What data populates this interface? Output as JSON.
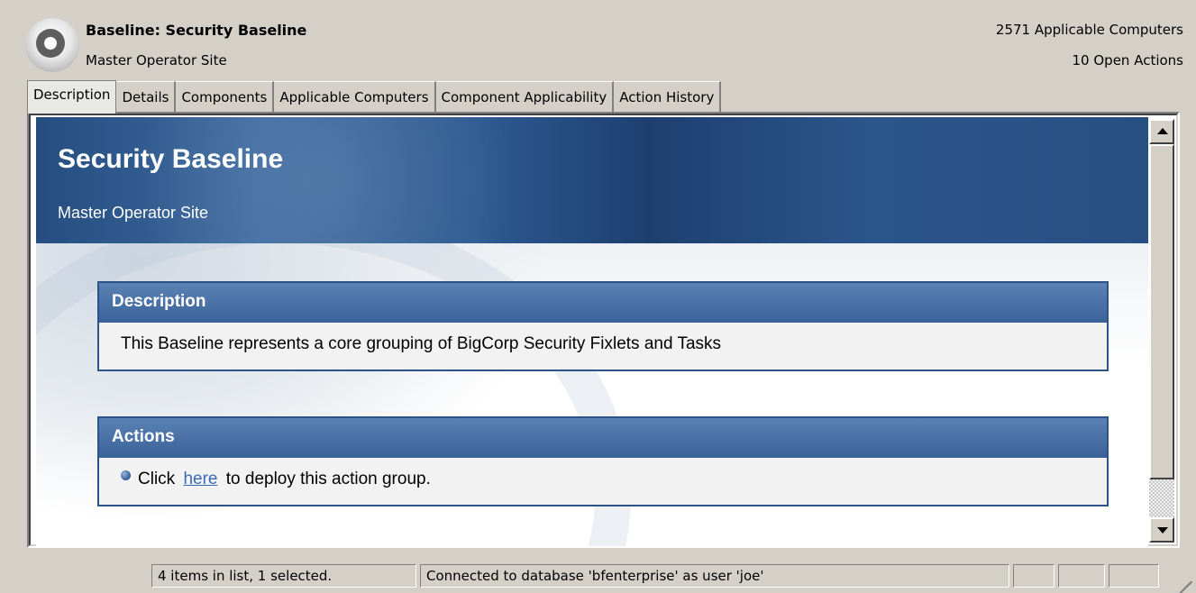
{
  "header": {
    "title": "Baseline: Security Baseline",
    "site": "Master Operator Site",
    "applicable_computers": "2571 Applicable Computers",
    "open_actions": "10 Open Actions"
  },
  "tabs": [
    {
      "label": "Description",
      "active": true
    },
    {
      "label": "Details",
      "active": false
    },
    {
      "label": "Components",
      "active": false
    },
    {
      "label": "Applicable Computers",
      "active": false
    },
    {
      "label": "Component Applicability",
      "active": false
    },
    {
      "label": "Action History",
      "active": false
    }
  ],
  "content": {
    "banner_title": "Security Baseline",
    "banner_subtitle": "Master Operator Site",
    "description_heading": "Description",
    "description_text": "This Baseline represents a core grouping of BigCorp Security Fixlets and Tasks",
    "actions_heading": "Actions",
    "action_prefix": "Click",
    "action_link": "here",
    "action_suffix": "to deploy this action group."
  },
  "status_bar": {
    "items": "4 items in list, 1 selected.",
    "connection": "Connected to database 'bfenterprise' as user 'joe'"
  },
  "colors": {
    "banner": "#2b568a",
    "panel_header": "#3a6299",
    "link": "#3a6bb5",
    "window_bg": "#d4d0c8"
  }
}
